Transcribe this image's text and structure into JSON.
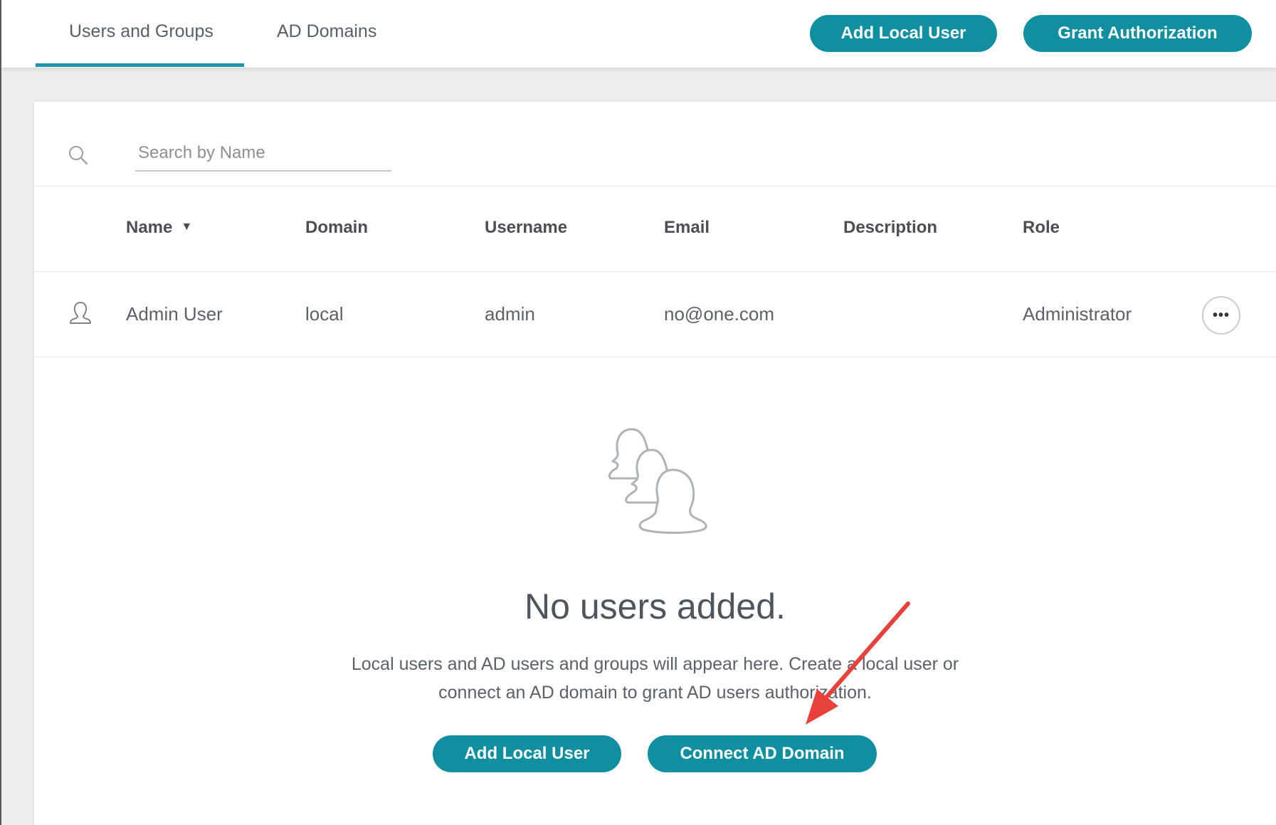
{
  "tabs": [
    {
      "label": "Users and Groups",
      "active": true
    },
    {
      "label": "AD Domains",
      "active": false
    }
  ],
  "header": {
    "add_local_user_label": "Add Local User",
    "grant_authorization_label": "Grant Authorization"
  },
  "search": {
    "placeholder": "Search by Name",
    "value": ""
  },
  "table": {
    "columns": [
      "Name",
      "Domain",
      "Username",
      "Email",
      "Description",
      "Role"
    ],
    "sort_column": "Name",
    "rows": [
      {
        "icon": "user-icon",
        "name": "Admin User",
        "domain": "local",
        "username": "admin",
        "email": "no@one.com",
        "description": "",
        "role": "Administrator"
      }
    ]
  },
  "empty_state": {
    "icon": "users-group-icon",
    "title": "No users added.",
    "description_line1": "Local users and AD users and groups will appear here. Create a local user or",
    "description_line2": "connect an AD domain to grant AD users authorization.",
    "add_local_user_label": "Add Local User",
    "connect_ad_domain_label": "Connect AD Domain"
  },
  "colors": {
    "accent": "#0f8f9f",
    "tab_underline": "#1b96a9",
    "annotation_arrow": "#e8413c"
  }
}
